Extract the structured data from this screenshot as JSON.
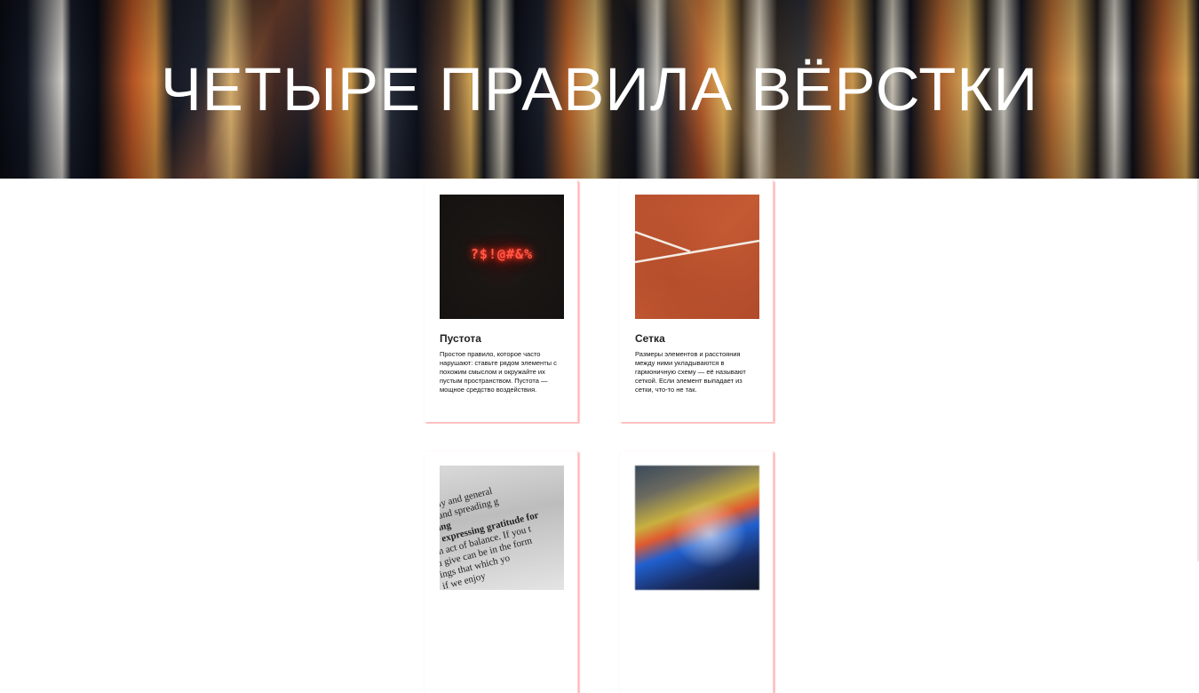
{
  "hero": {
    "title": "ЧЕТЫРЕ ПРАВИЛА ВЁРСТКИ"
  },
  "cards": [
    {
      "image_icon": "neon-symbols-photo",
      "neon_text": "?$!@#&%",
      "title": "Пустота",
      "text": "Простое правило, которое часто нарушают: ставьте рядом элементы с похожим смыслом и окружайте их пустым пространством. Пустота — мощное средство воздействия."
    },
    {
      "image_icon": "clay-court-photo",
      "title": "Сетка",
      "text": "Размеры элементов и расстояния между ними укладываются в гармоничную схему — её называют сеткой. Если элемент выпадает из сетки, что-то не так."
    },
    {
      "image_icon": "book-page-photo",
      "book_lines": [
        "ecialy and general",
        "ity and spreading g",
        "rding",
        "of expressing gratitude for",
        "an act of balance. If you t",
        "u give can be in the form",
        "ings that which yo",
        "if we enjoy"
      ],
      "title": "",
      "text": ""
    },
    {
      "image_icon": "rainbow-blur-photo",
      "title": "",
      "text": ""
    }
  ]
}
